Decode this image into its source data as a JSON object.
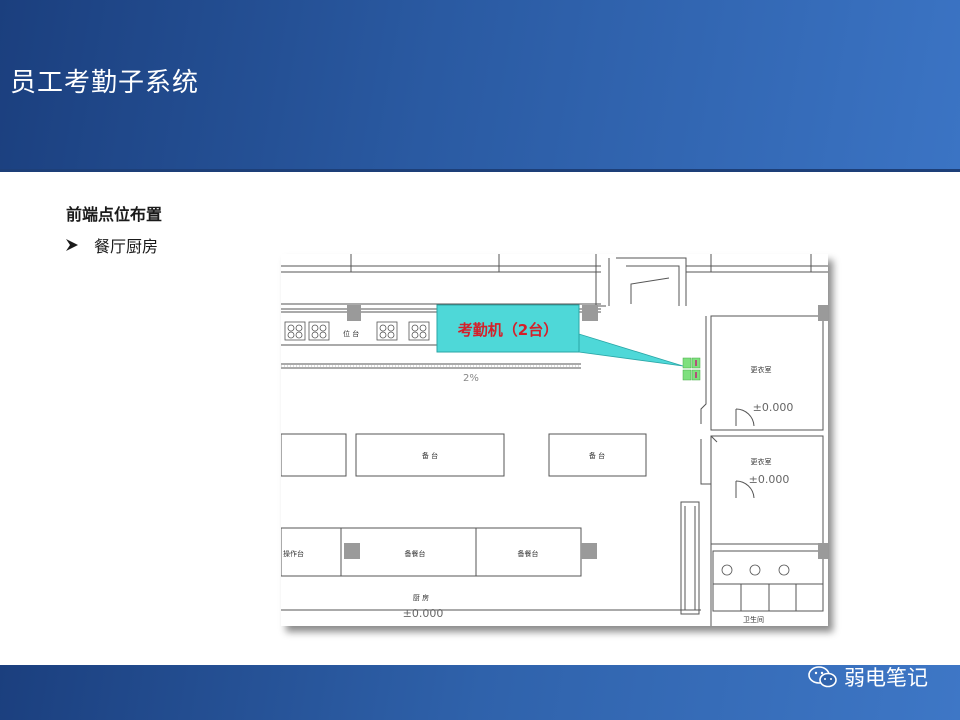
{
  "header": {
    "title": "员工考勤子系统"
  },
  "content": {
    "section_title": "前端点位布置",
    "bullet_text": "餐厅厨房"
  },
  "floor_plan": {
    "callout_label": "考勤机（2台）",
    "labels": {
      "counter_top_1": "位 台",
      "level_mark": "2%",
      "serving_counter": "备 台",
      "counter_right": "备 台",
      "prep_left": "操作台",
      "prep_1": "备餐台",
      "prep_2": "备餐台",
      "kitchen": "厨 房",
      "kitchen_elev": "±0.000",
      "room_upper": "更衣室",
      "room_upper_elev": "±0.000",
      "room_lower": "更衣室",
      "room_lower_elev": "±0.000",
      "bottom_corner": "卫生间"
    },
    "colors": {
      "callout_fill": "#4ed8d8",
      "callout_text": "#d4202a",
      "device_fill": "#7ee07e",
      "device_mark": "#c4207a",
      "column_fill": "#9a9a9a",
      "line": "#555555"
    }
  },
  "watermark": {
    "text": "弱电笔记",
    "icon": "wechat-icon"
  }
}
